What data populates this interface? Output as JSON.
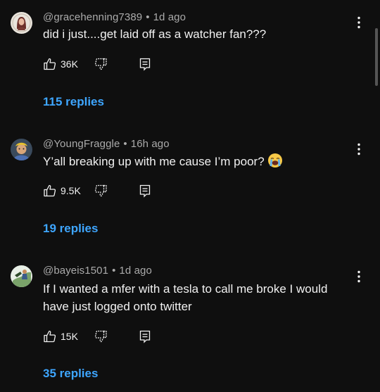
{
  "colors": {
    "background": "#0f0f0f",
    "text": "#f1f1f1",
    "meta": "#aaaaaa",
    "link": "#3ea6ff"
  },
  "comments": [
    {
      "handle": "@gracehenning7389",
      "time": "1d ago",
      "text": "did i just....get laid off as a watcher fan???",
      "likes": "36K",
      "replies": "115 replies",
      "avatar_icon": "user-avatar"
    },
    {
      "handle": "@YoungFraggle",
      "time": "16h ago",
      "text": "Y’all breaking up with me cause I’m poor?",
      "emoji": "loudly-crying-face-emoji",
      "likes": "9.5K",
      "replies": "19 replies",
      "avatar_icon": "user-avatar"
    },
    {
      "handle": "@bayeis1501",
      "time": "1d ago",
      "text": "If I wanted a mfer with a tesla to call me broke I would have just logged onto twitter",
      "likes": "15K",
      "replies": "35 replies",
      "avatar_icon": "user-avatar"
    }
  ],
  "icons": {
    "like": "thumbs-up-icon",
    "dislike": "thumbs-down-icon",
    "reply": "reply-icon",
    "menu": "more-vertical-icon"
  },
  "separator": "•"
}
